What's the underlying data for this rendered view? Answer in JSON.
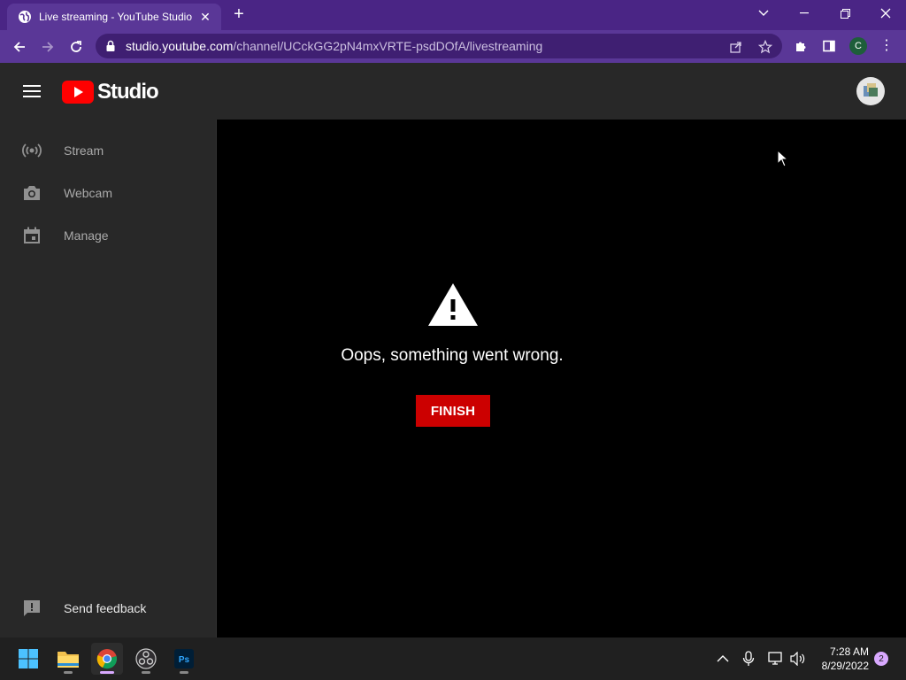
{
  "browser": {
    "tab_title": "Live streaming - YouTube Studio",
    "url_host": "studio.youtube.com",
    "url_path": "/channel/UCckGG2pN4mxVRTE-psdDOfA/livestreaming",
    "profile_initial": "C"
  },
  "studio": {
    "logo_text": "Studio",
    "sidebar": {
      "items": [
        {
          "label": "Stream",
          "icon": "stream-icon"
        },
        {
          "label": "Webcam",
          "icon": "camera-icon"
        },
        {
          "label": "Manage",
          "icon": "calendar-icon"
        }
      ],
      "feedback_label": "Send feedback"
    },
    "main": {
      "error_message": "Oops, something went wrong.",
      "finish_label": "FINISH"
    }
  },
  "taskbar": {
    "apps": [
      "windows-start",
      "file-explorer",
      "chrome",
      "obs-studio",
      "photoshop"
    ],
    "photoshop_label": "Ps",
    "time": "7:28 AM",
    "date": "8/29/2022",
    "notification_count": "2"
  },
  "colors": {
    "browser_frame": "#4a2585",
    "studio_bg": "#282828",
    "finish_button": "#cc0000",
    "youtube_red": "#ff0000"
  }
}
